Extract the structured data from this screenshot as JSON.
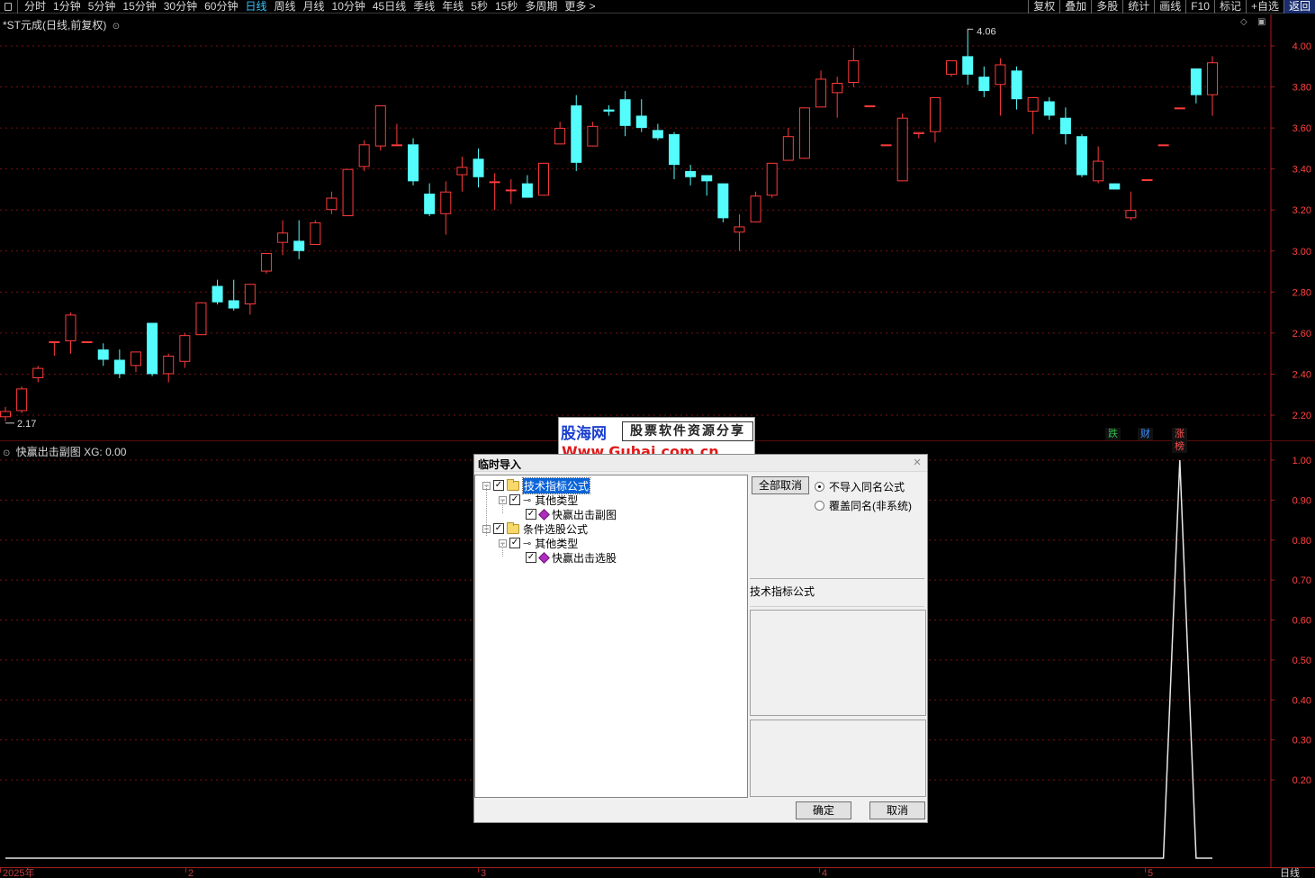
{
  "toolbar": {
    "periods": [
      "分时",
      "1分钟",
      "5分钟",
      "15分钟",
      "30分钟",
      "60分钟",
      "日线",
      "周线",
      "月线",
      "10分钟",
      "45日线",
      "季线",
      "年线",
      "5秒",
      "15秒",
      "多周期",
      "更多 >"
    ],
    "active_period": "日线",
    "right_tools": [
      "复权",
      "叠加",
      "多股",
      "统计",
      "画线",
      "F10",
      "标记",
      "+自选",
      "返回"
    ]
  },
  "main_chart": {
    "title": "*ST元成(日线,前复权)",
    "high_marker": "4.06",
    "low_marker": "2.17",
    "badges": [
      "跌",
      "财",
      "涨榜"
    ],
    "badge_colors": [
      "#2fbf4a",
      "#3a8cff",
      "#ff5050"
    ]
  },
  "sub_chart": {
    "title": "快赢出击副图  XG: 0.00"
  },
  "date_axis": {
    "labels": [
      "2025年",
      "2",
      "3",
      "4",
      "5"
    ],
    "right_label": "日线"
  },
  "colors": {
    "up": "#ff3b3b",
    "down": "#54fcfc",
    "grid": "#7a1010",
    "axis_text": "#ff4040",
    "frame": "#b01818"
  },
  "watermark": {
    "logo": "股海网",
    "tagline": "股票软件资源分享",
    "url": "Www.Guhai.com.cn"
  },
  "dialog": {
    "title": "临时导入",
    "tree": [
      {
        "label": "技术指标公式",
        "level": 0,
        "icon": "folder-icon",
        "checked": true,
        "selected": true
      },
      {
        "label": "其他类型",
        "level": 1,
        "icon": "key-icon",
        "checked": true
      },
      {
        "label": "快赢出击副图",
        "level": 2,
        "icon": "formula-icon",
        "checked": true
      },
      {
        "label": "条件选股公式",
        "level": 0,
        "icon": "folder-icon",
        "checked": true
      },
      {
        "label": "其他类型",
        "level": 1,
        "icon": "key-icon",
        "checked": true
      },
      {
        "label": "快赢出击选股",
        "level": 2,
        "icon": "formula-icon",
        "checked": true
      }
    ],
    "deselect_all": "全部取消",
    "option_skip": "不导入同名公式",
    "option_overwrite": "覆盖同名(非系统)",
    "selected_option": "option_skip",
    "section_label": "技术指标公式",
    "ok": "确定",
    "cancel": "取消"
  },
  "chart_data": [
    {
      "type": "candlestick",
      "title": "*ST元成(日线,前复权)",
      "ylim": [
        2.1,
        4.1
      ],
      "yticks": [
        2.2,
        2.4,
        2.6,
        2.8,
        3.0,
        3.2,
        3.4,
        3.6,
        3.8,
        4.0
      ],
      "candles": [
        {
          "o": 2.19,
          "h": 2.24,
          "l": 2.17,
          "c": 2.22
        },
        {
          "o": 2.22,
          "h": 2.34,
          "l": 2.21,
          "c": 2.33
        },
        {
          "o": 2.38,
          "h": 2.44,
          "l": 2.36,
          "c": 2.43
        },
        {
          "o": 2.56,
          "h": 2.56,
          "l": 2.49,
          "c": 2.56
        },
        {
          "o": 2.56,
          "h": 2.7,
          "l": 2.5,
          "c": 2.69
        },
        {
          "o": 2.56,
          "h": 2.56,
          "l": 2.56,
          "c": 2.56
        },
        {
          "o": 2.52,
          "h": 2.55,
          "l": 2.44,
          "c": 2.47
        },
        {
          "o": 2.47,
          "h": 2.52,
          "l": 2.38,
          "c": 2.4
        },
        {
          "o": 2.44,
          "h": 2.51,
          "l": 2.41,
          "c": 2.51
        },
        {
          "o": 2.65,
          "h": 2.65,
          "l": 2.39,
          "c": 2.4
        },
        {
          "o": 2.4,
          "h": 2.5,
          "l": 2.36,
          "c": 2.49
        },
        {
          "o": 2.46,
          "h": 2.6,
          "l": 2.43,
          "c": 2.59
        },
        {
          "o": 2.59,
          "h": 2.75,
          "l": 2.59,
          "c": 2.75
        },
        {
          "o": 2.83,
          "h": 2.86,
          "l": 2.74,
          "c": 2.75
        },
        {
          "o": 2.76,
          "h": 2.86,
          "l": 2.71,
          "c": 2.72
        },
        {
          "o": 2.74,
          "h": 2.84,
          "l": 2.69,
          "c": 2.84
        },
        {
          "o": 2.9,
          "h": 2.99,
          "l": 2.89,
          "c": 2.99
        },
        {
          "o": 3.04,
          "h": 3.15,
          "l": 2.98,
          "c": 3.09
        },
        {
          "o": 3.05,
          "h": 3.15,
          "l": 2.96,
          "c": 3.0
        },
        {
          "o": 3.03,
          "h": 3.15,
          "l": 3.03,
          "c": 3.14
        },
        {
          "o": 3.2,
          "h": 3.29,
          "l": 3.18,
          "c": 3.26
        },
        {
          "o": 3.17,
          "h": 3.4,
          "l": 3.17,
          "c": 3.4
        },
        {
          "o": 3.41,
          "h": 3.54,
          "l": 3.39,
          "c": 3.52
        },
        {
          "o": 3.51,
          "h": 3.71,
          "l": 3.49,
          "c": 3.71
        },
        {
          "o": 3.52,
          "h": 3.62,
          "l": 3.52,
          "c": 3.52
        },
        {
          "o": 3.52,
          "h": 3.55,
          "l": 3.32,
          "c": 3.34
        },
        {
          "o": 3.28,
          "h": 3.33,
          "l": 3.17,
          "c": 3.18
        },
        {
          "o": 3.18,
          "h": 3.34,
          "l": 3.08,
          "c": 3.29
        },
        {
          "o": 3.37,
          "h": 3.46,
          "l": 3.29,
          "c": 3.41
        },
        {
          "o": 3.45,
          "h": 3.5,
          "l": 3.31,
          "c": 3.36
        },
        {
          "o": 3.34,
          "h": 3.38,
          "l": 3.2,
          "c": 3.34
        },
        {
          "o": 3.3,
          "h": 3.35,
          "l": 3.23,
          "c": 3.3
        },
        {
          "o": 3.33,
          "h": 3.37,
          "l": 3.26,
          "c": 3.26
        },
        {
          "o": 3.27,
          "h": 3.42,
          "l": 3.27,
          "c": 3.43
        },
        {
          "o": 3.52,
          "h": 3.63,
          "l": 3.52,
          "c": 3.6
        },
        {
          "o": 3.71,
          "h": 3.76,
          "l": 3.39,
          "c": 3.43
        },
        {
          "o": 3.51,
          "h": 3.63,
          "l": 3.51,
          "c": 3.61
        },
        {
          "o": 3.69,
          "h": 3.71,
          "l": 3.66,
          "c": 3.68
        },
        {
          "o": 3.74,
          "h": 3.78,
          "l": 3.56,
          "c": 3.61
        },
        {
          "o": 3.66,
          "h": 3.74,
          "l": 3.58,
          "c": 3.6
        },
        {
          "o": 3.59,
          "h": 3.62,
          "l": 3.54,
          "c": 3.55
        },
        {
          "o": 3.57,
          "h": 3.58,
          "l": 3.35,
          "c": 3.42
        },
        {
          "o": 3.39,
          "h": 3.42,
          "l": 3.32,
          "c": 3.36
        },
        {
          "o": 3.37,
          "h": 3.37,
          "l": 3.27,
          "c": 3.34
        },
        {
          "o": 3.33,
          "h": 3.33,
          "l": 3.14,
          "c": 3.16
        },
        {
          "o": 3.09,
          "h": 3.18,
          "l": 3.0,
          "c": 3.12
        },
        {
          "o": 3.14,
          "h": 3.29,
          "l": 3.14,
          "c": 3.27
        },
        {
          "o": 3.27,
          "h": 3.42,
          "l": 3.26,
          "c": 3.43
        },
        {
          "o": 3.44,
          "h": 3.6,
          "l": 3.44,
          "c": 3.56
        },
        {
          "o": 3.45,
          "h": 3.7,
          "l": 3.45,
          "c": 3.7
        },
        {
          "o": 3.7,
          "h": 3.88,
          "l": 3.7,
          "c": 3.84
        },
        {
          "o": 3.77,
          "h": 3.85,
          "l": 3.65,
          "c": 3.82
        },
        {
          "o": 3.82,
          "h": 3.99,
          "l": 3.8,
          "c": 3.93
        },
        {
          "o": 3.71,
          "h": 3.71,
          "l": 3.71,
          "c": 3.71
        },
        {
          "o": 3.52,
          "h": 3.52,
          "l": 3.52,
          "c": 3.52
        },
        {
          "o": 3.34,
          "h": 3.67,
          "l": 3.34,
          "c": 3.65
        },
        {
          "o": 3.57,
          "h": 3.58,
          "l": 3.55,
          "c": 3.58
        },
        {
          "o": 3.58,
          "h": 3.74,
          "l": 3.53,
          "c": 3.75
        },
        {
          "o": 3.86,
          "h": 3.92,
          "l": 3.85,
          "c": 3.93
        },
        {
          "o": 3.95,
          "h": 4.06,
          "l": 3.81,
          "c": 3.86
        },
        {
          "o": 3.85,
          "h": 3.9,
          "l": 3.75,
          "c": 3.78
        },
        {
          "o": 3.81,
          "h": 3.94,
          "l": 3.66,
          "c": 3.91
        },
        {
          "o": 3.88,
          "h": 3.9,
          "l": 3.69,
          "c": 3.74
        },
        {
          "o": 3.68,
          "h": 3.74,
          "l": 3.57,
          "c": 3.75
        },
        {
          "o": 3.73,
          "h": 3.75,
          "l": 3.64,
          "c": 3.66
        },
        {
          "o": 3.65,
          "h": 3.7,
          "l": 3.52,
          "c": 3.57
        },
        {
          "o": 3.56,
          "h": 3.57,
          "l": 3.36,
          "c": 3.37
        },
        {
          "o": 3.34,
          "h": 3.51,
          "l": 3.33,
          "c": 3.44
        },
        {
          "o": 3.33,
          "h": 3.33,
          "l": 3.3,
          "c": 3.3
        },
        {
          "o": 3.16,
          "h": 3.29,
          "l": 3.15,
          "c": 3.2
        },
        {
          "o": 3.35,
          "h": 3.35,
          "l": 3.35,
          "c": 3.35
        },
        {
          "o": 3.52,
          "h": 3.52,
          "l": 3.52,
          "c": 3.52
        },
        {
          "o": 3.7,
          "h": 3.7,
          "l": 3.7,
          "c": 3.7
        },
        {
          "o": 3.89,
          "h": 3.89,
          "l": 3.72,
          "c": 3.76
        },
        {
          "o": 3.76,
          "h": 3.95,
          "l": 3.66,
          "c": 3.92
        }
      ]
    },
    {
      "type": "line",
      "title": "快赢出击副图",
      "series": [
        {
          "name": "XG",
          "values": [
            0,
            0,
            0,
            0,
            0,
            0,
            0,
            0,
            0,
            0,
            0,
            0,
            0,
            0,
            0,
            0,
            0,
            0,
            0,
            0,
            0,
            0,
            0,
            0,
            0,
            0,
            0,
            0,
            0,
            0,
            0,
            0,
            0,
            0,
            0,
            0,
            0,
            0,
            0,
            0,
            0,
            0,
            0,
            0,
            0,
            0,
            0,
            0,
            0,
            0,
            0,
            0,
            0,
            0,
            0,
            0,
            0,
            0,
            0,
            0,
            0,
            0,
            0,
            0,
            0,
            0,
            0,
            0,
            0,
            0,
            0,
            0,
            1,
            0,
            0
          ]
        }
      ],
      "ylim": [
        0.1,
        1.05
      ],
      "yticks": [
        0.2,
        0.3,
        0.4,
        0.5,
        0.6,
        0.7,
        0.8,
        0.9,
        1.0
      ]
    }
  ]
}
